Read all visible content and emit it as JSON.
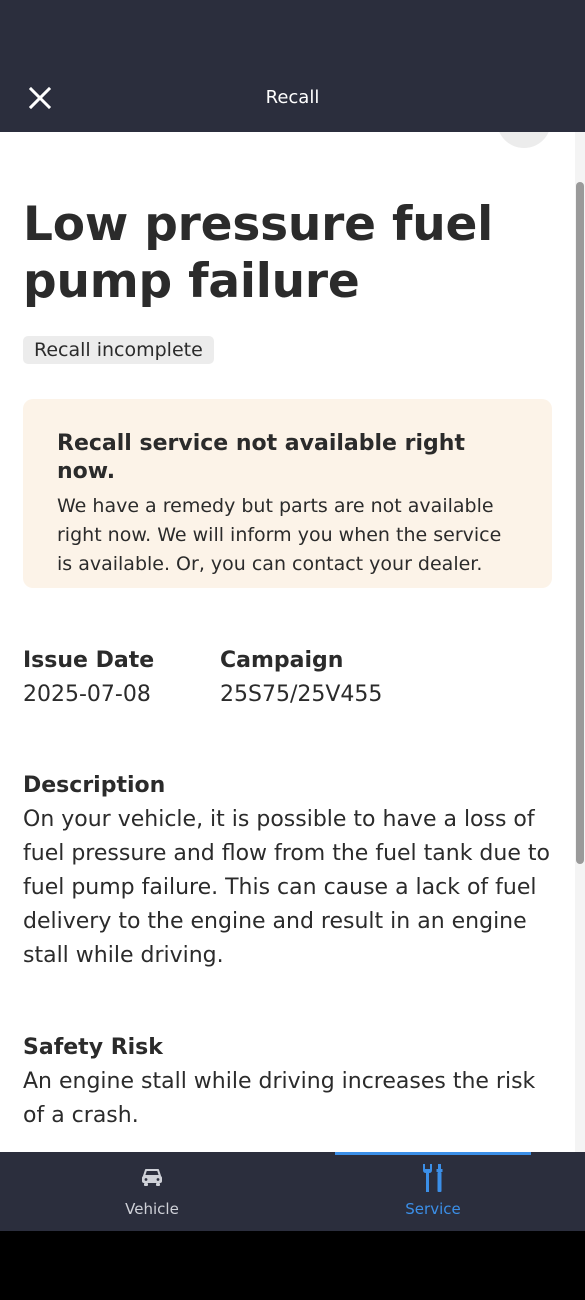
{
  "header": {
    "title": "Recall",
    "close_icon": "close-icon"
  },
  "recall": {
    "title": "Low pressure fuel pump failure",
    "status": "Recall incomplete",
    "notice": {
      "title": "Recall service not available right now.",
      "body": "We have a remedy but parts are not available right now. We will inform you when the service is available. Or, you can contact your dealer."
    },
    "issue_date": {
      "label": "Issue Date",
      "value": "2025-07-08"
    },
    "campaign": {
      "label": "Campaign",
      "value": "25S75/25V455"
    },
    "description": {
      "label": "Description",
      "text": "On your vehicle, it is possible to have a loss of fuel pressure and flow from the fuel tank due to fuel pump failure. This can cause a lack of fuel delivery to the engine and result in an engine stall while driving."
    },
    "safety_risk": {
      "label": "Safety Risk",
      "text": "An engine stall while driving increases the risk of a crash."
    }
  },
  "bottom_nav": {
    "tabs": [
      {
        "label": "Vehicle",
        "icon": "car-icon",
        "active": false
      },
      {
        "label": "Service",
        "icon": "wrench-screwdriver-icon",
        "active": true
      }
    ]
  },
  "colors": {
    "header_bg": "#2b2e3d",
    "accent": "#3b8fe8",
    "notice_bg": "#fcf3e8",
    "badge_bg": "#ececec",
    "text": "#2b2b2b"
  }
}
